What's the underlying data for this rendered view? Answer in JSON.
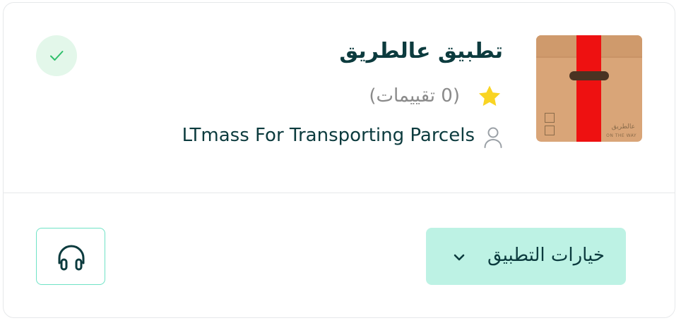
{
  "app": {
    "title": "تطبيق عالطريق",
    "rating_text": "(0 تقييمات)",
    "rating_star_color": "#f9d423",
    "company": "LTmass For Transporting Parcels",
    "thumbnail": {
      "brand_text": "عالطريق",
      "brand_subtext": "ON THE WAY",
      "box_color": "#d9a578",
      "strap_color": "#ee1111"
    },
    "status": {
      "icon": "check-icon",
      "color": "#2fbf6b"
    }
  },
  "actions": {
    "options_label": "خيارات التطبيق",
    "options_icon": "chevron-down-icon",
    "support_icon": "headphones-icon",
    "accent": "#bdf2e4"
  }
}
